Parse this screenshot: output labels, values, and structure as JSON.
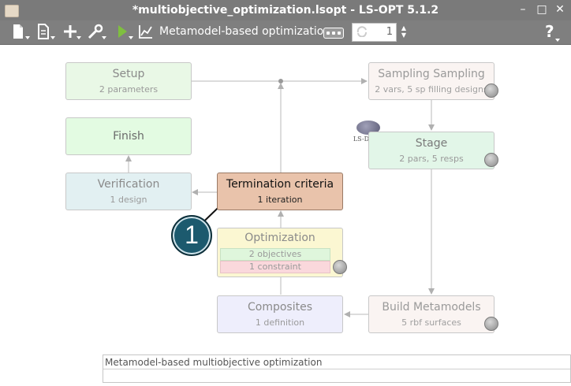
{
  "window": {
    "title": "*multiobjective_optimization.lsopt - LS-OPT 5.1.2"
  },
  "toolbar": {
    "task_label": "Metamodel-based optimization",
    "iteration_value": "1",
    "help_label": "?"
  },
  "boxes": {
    "setup": {
      "name": "Setup",
      "sub": "2 parameters"
    },
    "sampling": {
      "name": "Sampling Sampling",
      "sub": "2 vars, 5 sp filling designs"
    },
    "finish": {
      "name": "Finish"
    },
    "stage": {
      "name": "Stage",
      "sub": "2 pars, 5 resps",
      "solver_label": "LS-DYNA"
    },
    "verification": {
      "name": "Verification",
      "sub": "1 design"
    },
    "termination": {
      "name": "Termination criteria",
      "sub": "1 iteration"
    },
    "optimization": {
      "name": "Optimization",
      "objectives": "2 objectives",
      "constraints": "1 constraint"
    },
    "composites": {
      "name": "Composites",
      "sub": "1 definition"
    },
    "metamodels": {
      "name": "Build Metamodels",
      "sub": "5 rbf surfaces"
    }
  },
  "callout": {
    "number": "1"
  },
  "status": {
    "text": "Metamodel-based multiobjective optimization"
  }
}
